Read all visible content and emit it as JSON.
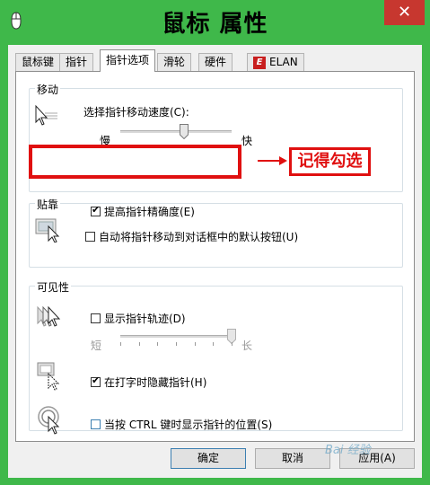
{
  "window": {
    "title": "鼠标 属性",
    "close_glyph": "✕"
  },
  "tabs": [
    {
      "label": "鼠标键"
    },
    {
      "label": "指针"
    },
    {
      "label": "指针选项"
    },
    {
      "label": "滑轮"
    },
    {
      "label": "硬件"
    },
    {
      "label": "ELAN",
      "logo_text": "E"
    }
  ],
  "active_tab": "指针选项",
  "motion": {
    "group_label": "移动",
    "speed_label": "选择指针移动速度(C):",
    "slow_label": "慢",
    "fast_label": "快",
    "speed_level": 0.57,
    "precision_label": "提高指针精确度(E)",
    "precision_checked": true
  },
  "snap": {
    "group_label": "贴靠",
    "snap_label": "自动将指针移动到对话框中的默认按钮(U)",
    "snap_checked": false
  },
  "visibility": {
    "group_label": "可见性",
    "trails_label": "显示指针轨迹(D)",
    "trails_checked": false,
    "short_label": "短",
    "long_label": "长",
    "trail_level": 1.0,
    "hide_typing_label": "在打字时隐藏指针(H)",
    "hide_typing_checked": true,
    "ctrl_locate_label": "当按 CTRL 键时显示指针的位置(S)",
    "ctrl_locate_checked": false
  },
  "buttons": {
    "ok": "确定",
    "cancel": "取消",
    "apply": "应用(A)"
  },
  "annotation": {
    "note": "记得勾选",
    "color": "#e01010"
  },
  "watermark": "Bai 经验",
  "colors": {
    "title_bar": "#3fb84a",
    "close_button": "#c7372f",
    "annotation_red": "#e01010"
  }
}
